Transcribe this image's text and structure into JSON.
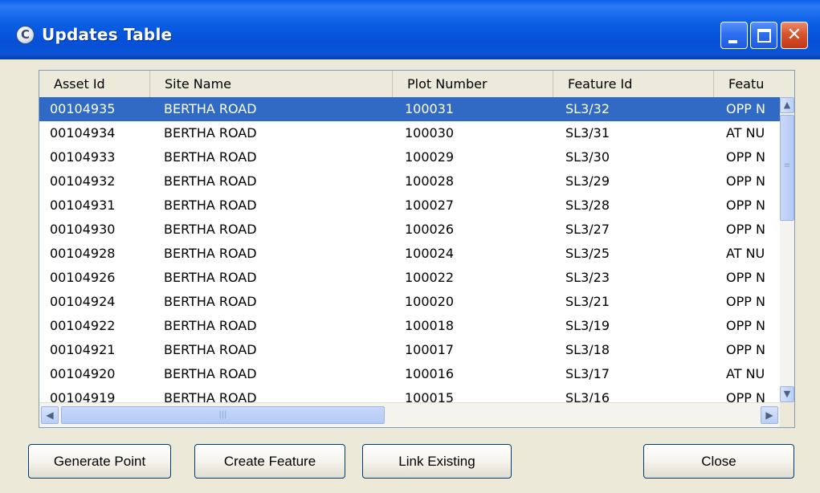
{
  "window": {
    "title": "Updates Table",
    "app_icon_glyph": "C",
    "controls": {
      "minimize_icon": "minimize-icon",
      "maximize_icon": "maximize-icon",
      "close_glyph": "✕"
    }
  },
  "table": {
    "columns": [
      "Asset Id",
      "Site Name",
      "Plot Number",
      "Feature Id",
      "Featu"
    ],
    "selected_row_index": 0,
    "rows": [
      [
        "00104935",
        "BERTHA ROAD",
        "100031",
        "SL3/32",
        "OPP N"
      ],
      [
        "00104934",
        "BERTHA ROAD",
        "100030",
        "SL3/31",
        "AT NU"
      ],
      [
        "00104933",
        "BERTHA ROAD",
        "100029",
        "SL3/30",
        "OPP N"
      ],
      [
        "00104932",
        "BERTHA ROAD",
        "100028",
        "SL3/29",
        "OPP N"
      ],
      [
        "00104931",
        "BERTHA ROAD",
        "100027",
        "SL3/28",
        "OPP N"
      ],
      [
        "00104930",
        "BERTHA ROAD",
        "100026",
        "SL3/27",
        "OPP N"
      ],
      [
        "00104928",
        "BERTHA ROAD",
        "100024",
        "SL3/25",
        "AT NU"
      ],
      [
        "00104926",
        "BERTHA ROAD",
        "100022",
        "SL3/23",
        "OPP N"
      ],
      [
        "00104924",
        "BERTHA ROAD",
        "100020",
        "SL3/21",
        "OPP N"
      ],
      [
        "00104922",
        "BERTHA ROAD",
        "100018",
        "SL3/19",
        "OPP N"
      ],
      [
        "00104921",
        "BERTHA ROAD",
        "100017",
        "SL3/18",
        "OPP N"
      ],
      [
        "00104920",
        "BERTHA ROAD",
        "100016",
        "SL3/17",
        "AT NU"
      ],
      [
        "00104919",
        "BERTHA ROAD",
        "100015",
        "SL3/16",
        "OPP N"
      ]
    ],
    "scroll": {
      "up_glyph": "▲",
      "down_glyph": "▼",
      "left_glyph": "◀",
      "right_glyph": "▶",
      "v_grip": "≡",
      "h_grip": "|||"
    }
  },
  "buttons": {
    "generate_point": "Generate Point",
    "create_feature": "Create Feature",
    "link_existing": "Link Existing",
    "close": "Close"
  }
}
